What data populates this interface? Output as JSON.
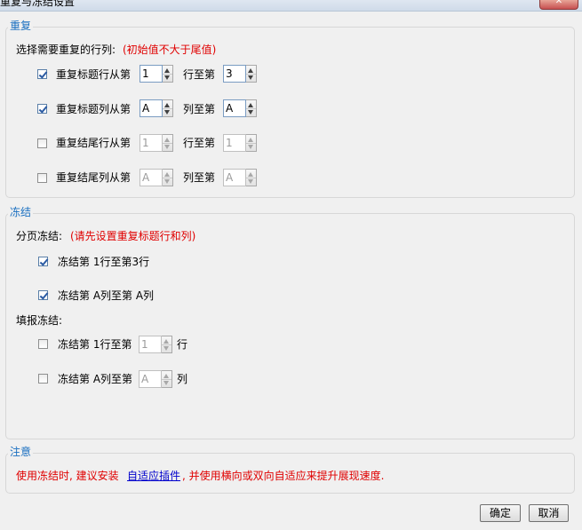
{
  "window": {
    "title": "重复与冻结设置",
    "close_glyph": "✕"
  },
  "repeat": {
    "group_title": "重复",
    "prompt": "选择需要重复的行列:",
    "hint": "(初始值不大于尾值)",
    "rows": [
      {
        "label": "重复标题行从第",
        "checked": true,
        "from": "1",
        "to_label": "行至第",
        "to": "3",
        "enabled": true
      },
      {
        "label": "重复标题列从第",
        "checked": true,
        "from": "A",
        "to_label": "列至第",
        "to": "A",
        "enabled": true
      },
      {
        "label": "重复结尾行从第",
        "checked": false,
        "from": "1",
        "to_label": "行至第",
        "to": "1",
        "enabled": false
      },
      {
        "label": "重复结尾列从第",
        "checked": false,
        "from": "A",
        "to_label": "列至第",
        "to": "A",
        "enabled": false
      }
    ]
  },
  "freeze": {
    "group_title": "冻结",
    "page_prompt": "分页冻结:",
    "page_hint": "(请先设置重复标题行和列)",
    "page_rows": [
      {
        "label": "冻结第 1行至第3行",
        "checked": true
      },
      {
        "label": "冻结第 A列至第 A列",
        "checked": true
      }
    ],
    "fill_prompt": "填报冻结:",
    "fill_rows": [
      {
        "label": "冻结第 1行至第",
        "checked": false,
        "value": "1",
        "suffix": "行"
      },
      {
        "label": "冻结第 A列至第",
        "checked": false,
        "value": "A",
        "suffix": "列"
      }
    ]
  },
  "note": {
    "group_title": "注意",
    "text_before": "使用冻结时, 建议安装",
    "link": "自适应插件",
    "text_after": ", 并使用横向或双向自适应来提升展现速度."
  },
  "footer": {
    "ok": "确定",
    "cancel": "取消"
  }
}
